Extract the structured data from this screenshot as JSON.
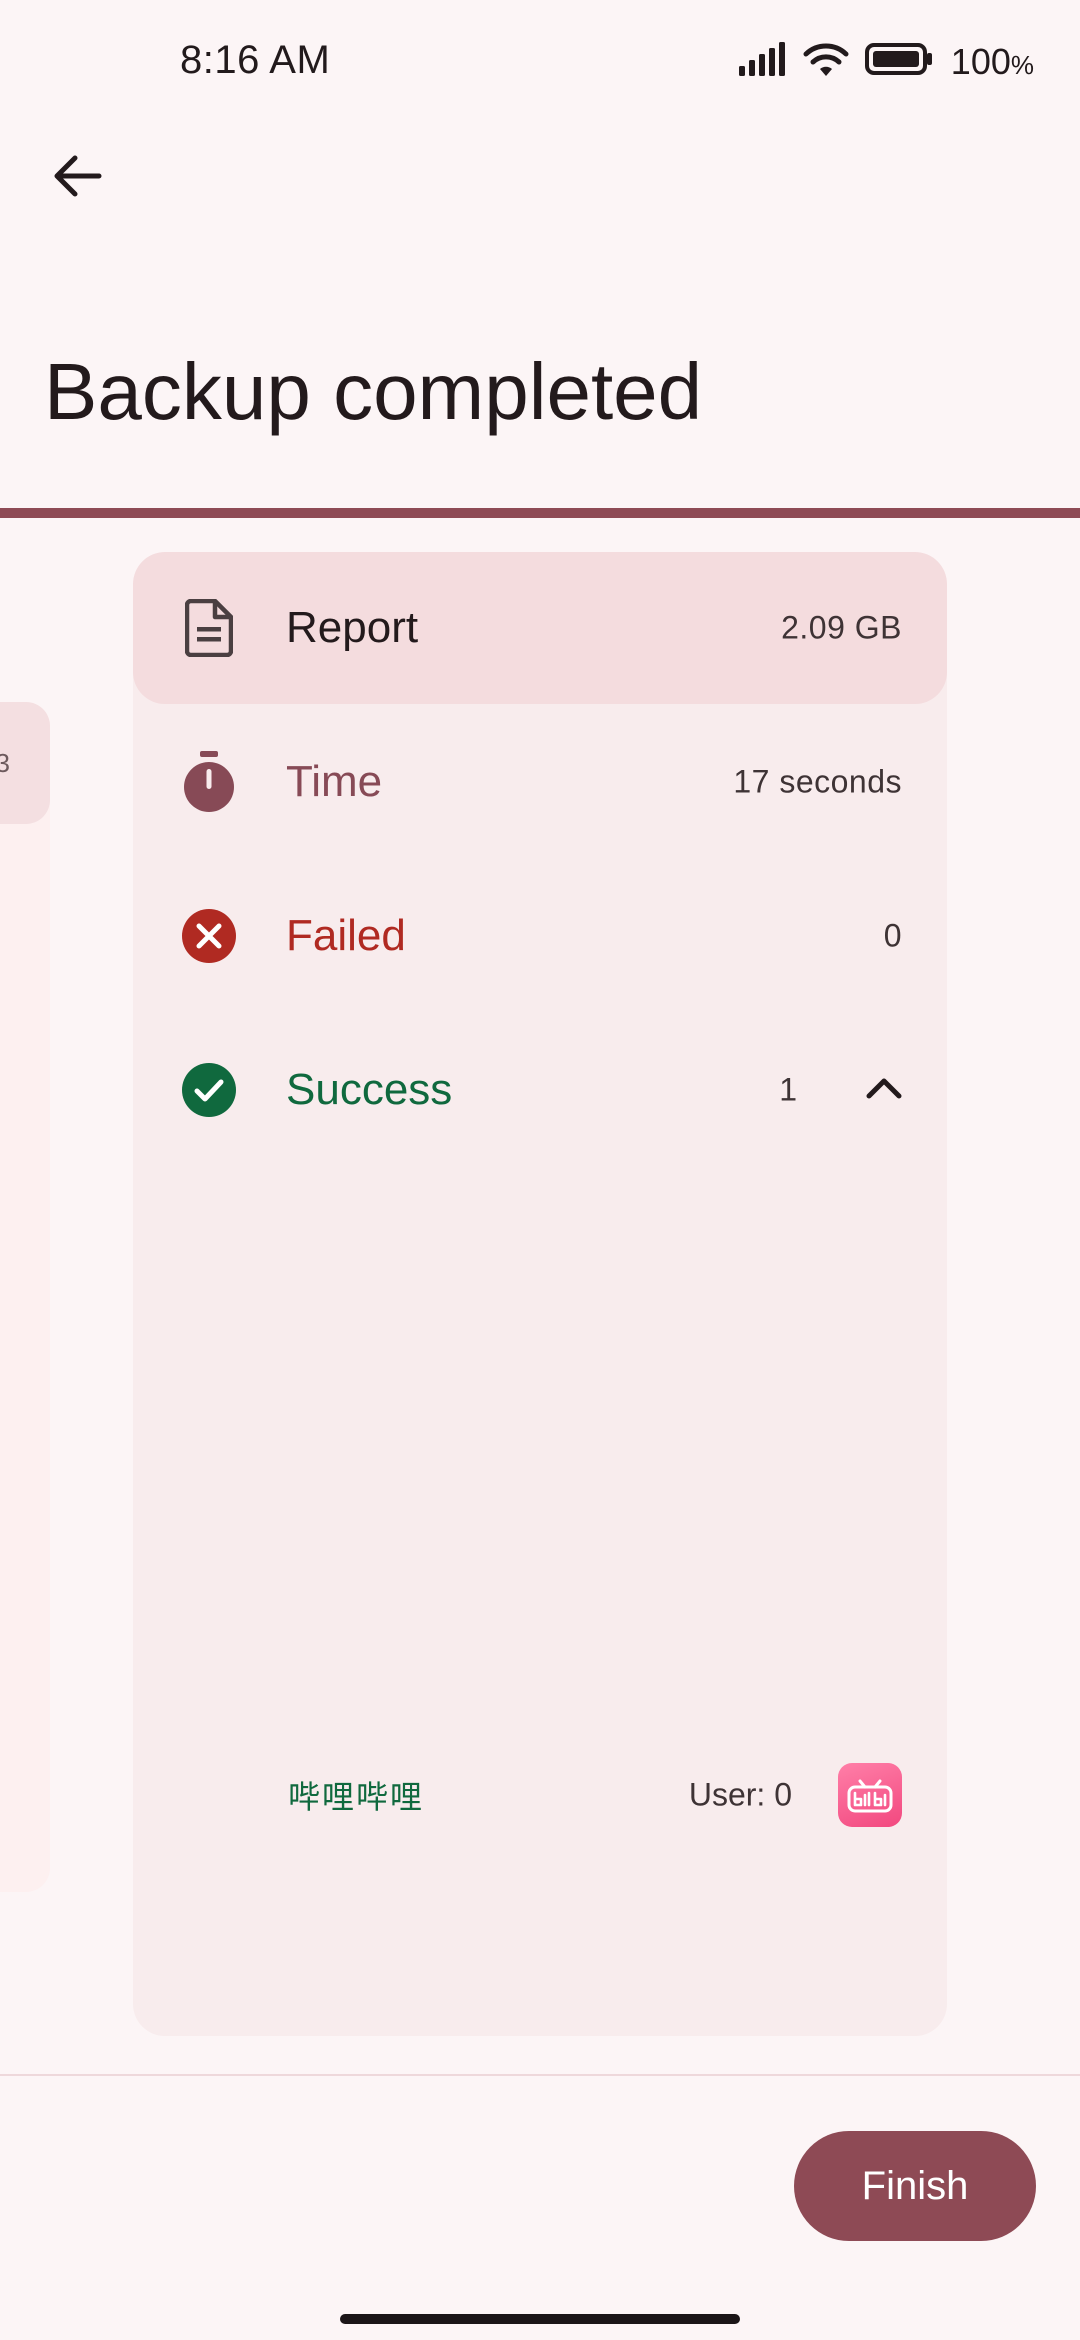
{
  "status_bar": {
    "time": "8:16 AM",
    "battery_percent": "100",
    "battery_unit": "%"
  },
  "header": {
    "title": "Backup completed"
  },
  "side_card": {
    "peek_text": "3"
  },
  "report": {
    "header": {
      "label": "Report",
      "value": "2.09 GB",
      "icon": "document-icon"
    },
    "time": {
      "label": "Time",
      "value": "17 seconds",
      "icon": "timer-icon"
    },
    "failed": {
      "label": "Failed",
      "value": "0",
      "icon": "error-circle-icon"
    },
    "success": {
      "label": "Success",
      "value": "1",
      "icon": "check-circle-icon",
      "expanded": true
    },
    "apps": [
      {
        "name": "哔哩哔哩",
        "user": "User: 0",
        "icon": "bilibili-app-icon"
      }
    ]
  },
  "footer": {
    "finish_label": "Finish"
  },
  "colors": {
    "accent": "#8e4a55",
    "background": "#fcf5f6",
    "card": "#f8eced",
    "card_header": "#f4dcde",
    "failed": "#b02a22",
    "success": "#10693e",
    "time": "#874a56"
  }
}
